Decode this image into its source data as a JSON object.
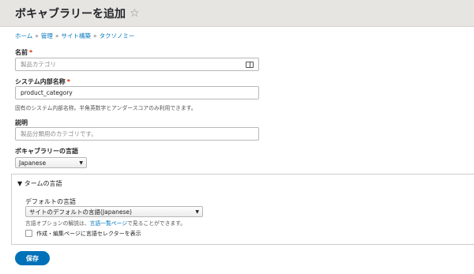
{
  "page": {
    "title": "ボキャブラリーを追加",
    "star_icon": "star-icon"
  },
  "breadcrumb": [
    {
      "label": "ホーム"
    },
    {
      "label": "管理"
    },
    {
      "label": "サイト構築"
    },
    {
      "label": "タクソノミー"
    }
  ],
  "breadcrumb_separator": "»",
  "form": {
    "name": {
      "label": "名前",
      "required": "*",
      "placeholder": "製品カテゴリ",
      "icon": "book-icon"
    },
    "machine_name": {
      "label": "システム内部名称",
      "required": "*",
      "value": "product_category",
      "description": "固有のシステム内部名称。半角英数字とアンダースコアのみ利用できます。"
    },
    "description": {
      "label": "説明",
      "placeholder": "製品分類用のカテゴリです。"
    },
    "language": {
      "label": "ボキャブラリーの言語",
      "selected": "Japanese"
    },
    "term_language": {
      "summary": "▼ タームの言語",
      "default_label": "デフォルトの言語",
      "default_selected": "サイトのデフォルトの言語(Japanese)",
      "help_prefix": "言語オプションの解説は、",
      "help_link": "言語一覧ページ",
      "help_suffix": "で見ることができます。",
      "checkbox_label": "作成・編集ページに言語セレクターを表示"
    },
    "save_label": "保存"
  },
  "colors": {
    "accent": "#0071b8",
    "required": "#e62600",
    "link": "#0074bd"
  }
}
